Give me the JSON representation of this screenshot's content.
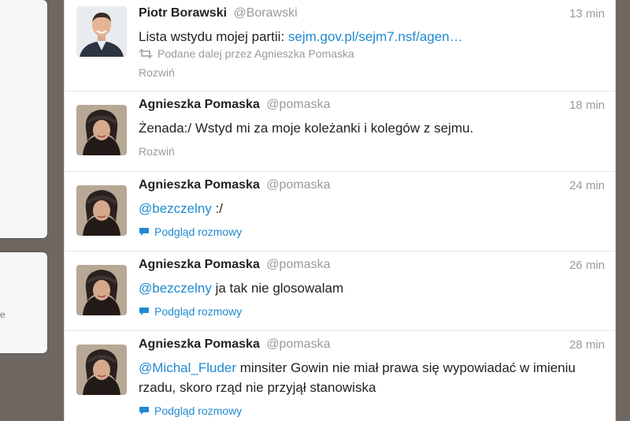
{
  "tweets": [
    {
      "author": "Piotr Borawski",
      "handle": "@Borawski",
      "time": "13 min",
      "text": "Lista wstydu mojej partii: ",
      "link": "sejm.gov.pl/sejm7.nsf/agen…",
      "retweeted_by": "Podane dalej przez Agnieszka Pomaska",
      "action": "Rozwiń",
      "avatar_icon": "man-avatar"
    },
    {
      "author": "Agnieszka Pomaska",
      "handle": "@pomaska",
      "time": "18 min",
      "text": "Żenada:/ Wstyd mi za moje koleżanki i kolegów z sejmu.",
      "action": "Rozwiń",
      "avatar_icon": "woman-avatar"
    },
    {
      "author": "Agnieszka Pomaska",
      "handle": "@pomaska",
      "time": "24 min",
      "mention": "@bezczelny",
      "text": " :/",
      "action": "Podgląd rozmowy",
      "avatar_icon": "woman-avatar"
    },
    {
      "author": "Agnieszka Pomaska",
      "handle": "@pomaska",
      "time": "26 min",
      "mention": "@bezczelny",
      "text": " ja tak nie glosowalam",
      "action": "Podgląd rozmowy",
      "avatar_icon": "woman-avatar"
    },
    {
      "author": "Agnieszka Pomaska",
      "handle": "@pomaska",
      "time": "28 min",
      "mention": "@Michal_Fluder",
      "text": " minsiter Gowin nie miał prawa się wypowiadać w imieniu rzadu, skoro rząd nie przyjął stanowiska",
      "action": "Podgląd rozmowy",
      "avatar_icon": "woman-avatar"
    }
  ],
  "side": {
    "fragment": "e"
  },
  "colors": {
    "link": "#1f8ad1",
    "meta": "#9a9a9a",
    "background": "#6e6762"
  }
}
